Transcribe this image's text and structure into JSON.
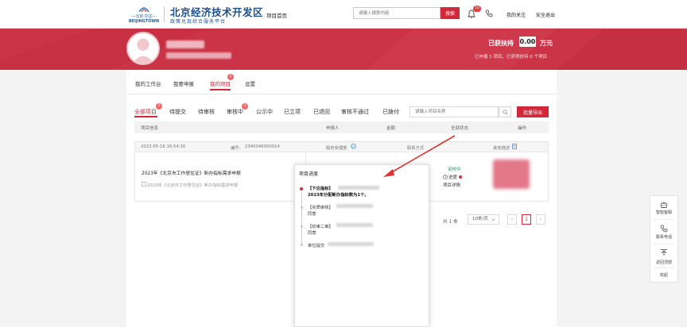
{
  "header": {
    "logo_brand": "BEIJINGTOWN",
    "logo_cn": "—北京·亦庄—",
    "site_title": "北京经济技术开发区",
    "site_subtitle": "政策兑现综合服务平台",
    "nav_home": "项目首页",
    "search_placeholder": "请输入搜索内容",
    "search_button": "搜索",
    "notification_count": "10",
    "my_follow": "我的关注",
    "logout": "安全退出"
  },
  "banner": {
    "support_label": "已获扶持",
    "support_value": "0.00",
    "support_unit": "万元",
    "support_summary": "已申报 1 项目，已获得扶持 0 个项目"
  },
  "page_tabs": {
    "items": [
      {
        "label": "我的工作台"
      },
      {
        "label": "我要申报"
      },
      {
        "label": "我的项目"
      },
      {
        "label": "设置"
      }
    ],
    "active": "我的项目",
    "badge": "1"
  },
  "status_tabs": {
    "items": [
      {
        "label": "全部项目",
        "badge": "1"
      },
      {
        "label": "待提交"
      },
      {
        "label": "待审核"
      },
      {
        "label": "审核中",
        "badge": "1"
      },
      {
        "label": "公示中"
      },
      {
        "label": "已立项"
      },
      {
        "label": "已退回"
      },
      {
        "label": "审核不通过"
      },
      {
        "label": "已拨付"
      }
    ],
    "active": "全部项目",
    "project_search_placeholder": "请输入项目名称",
    "export_button": "批量导出"
  },
  "table": {
    "headers": {
      "info": "项目信息",
      "applicant": "申报人",
      "amount": "金额",
      "status": "全部状态",
      "action": "操作"
    },
    "row": {
      "datetime": "2023-05-16 16:54:30",
      "number_label": "编号：",
      "number": "2340046000014",
      "accept_dept": "服务受理部",
      "contact": "联系方式",
      "other": "其他描述",
      "title": "2023年《北京市工作居住证》新办指标需求申报",
      "subtitle": "2023年《北京市工作居住证》新办指标需求申报",
      "status": "审核中",
      "progress_link": "进度",
      "detail_link": "项目详情"
    }
  },
  "pagination": {
    "total": "共 1 条",
    "page_size": "10条/页",
    "current_page": "1"
  },
  "progress_popup": {
    "title": "项目进度",
    "steps": [
      {
        "tag": "【下达指标】",
        "note": "2023年分配新办指标数为1个。"
      },
      {
        "tag": "【实质审核】",
        "note": "同意"
      },
      {
        "tag": "【初审二审】",
        "note": "同意"
      },
      {
        "tag": "单位提交"
      }
    ]
  },
  "float_toolbar": {
    "items": [
      {
        "label": "智能客服",
        "icon": "robot-icon"
      },
      {
        "label": "联系电话",
        "icon": "phone-icon"
      },
      {
        "label": "返回顶部",
        "icon": "to-top-icon"
      },
      {
        "label": "收起",
        "icon": "collapse-icon"
      }
    ]
  },
  "colors": {
    "brand_red": "#d2283a",
    "banner_red": "#cb3446",
    "status_green": "#2da36e",
    "title_blue": "#1f4e8c"
  }
}
